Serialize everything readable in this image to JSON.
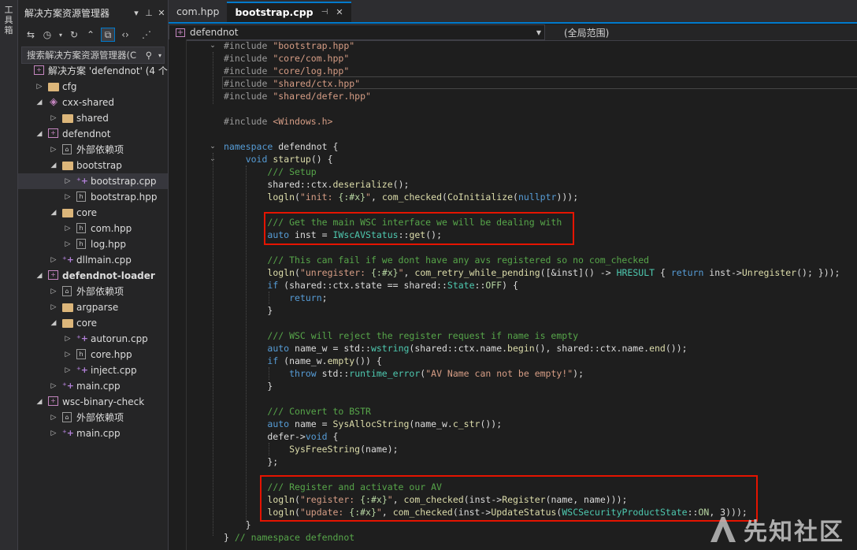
{
  "toolstrip": {
    "label": "工具箱"
  },
  "solution_explorer": {
    "title": "解决方案资源管理器",
    "search_placeholder": "搜索解决方案资源管理器(C",
    "tree": [
      {
        "label": "解决方案 'defendnot' (4 个",
        "depth": 0,
        "arrow": "",
        "icon": "solution"
      },
      {
        "label": "cfg",
        "depth": 1,
        "arrow": "▷",
        "icon": "folder"
      },
      {
        "label": "cxx-shared",
        "depth": 1,
        "arrow": "◢",
        "icon": "shared-project"
      },
      {
        "label": "shared",
        "depth": 2,
        "arrow": "▷",
        "icon": "folder"
      },
      {
        "label": "defendnot",
        "depth": 1,
        "arrow": "◢",
        "icon": "project"
      },
      {
        "label": "外部依赖项",
        "depth": 2,
        "arrow": "▷",
        "icon": "external"
      },
      {
        "label": "bootstrap",
        "depth": 2,
        "arrow": "◢",
        "icon": "folder"
      },
      {
        "label": "bootstrap.cpp",
        "depth": 3,
        "arrow": "▷",
        "icon": "cpp",
        "selected": true
      },
      {
        "label": "bootstrap.hpp",
        "depth": 3,
        "arrow": "▷",
        "icon": "hpp"
      },
      {
        "label": "core",
        "depth": 2,
        "arrow": "◢",
        "icon": "folder"
      },
      {
        "label": "com.hpp",
        "depth": 3,
        "arrow": "▷",
        "icon": "hpp"
      },
      {
        "label": "log.hpp",
        "depth": 3,
        "arrow": "▷",
        "icon": "hpp"
      },
      {
        "label": "dllmain.cpp",
        "depth": 2,
        "arrow": "▷",
        "icon": "cpp"
      },
      {
        "label": "defendnot-loader",
        "depth": 1,
        "arrow": "◢",
        "icon": "project",
        "bold": true
      },
      {
        "label": "外部依赖项",
        "depth": 2,
        "arrow": "▷",
        "icon": "external"
      },
      {
        "label": "argparse",
        "depth": 2,
        "arrow": "▷",
        "icon": "folder"
      },
      {
        "label": "core",
        "depth": 2,
        "arrow": "◢",
        "icon": "folder"
      },
      {
        "label": "autorun.cpp",
        "depth": 3,
        "arrow": "▷",
        "icon": "cpp"
      },
      {
        "label": "core.hpp",
        "depth": 3,
        "arrow": "▷",
        "icon": "hpp"
      },
      {
        "label": "inject.cpp",
        "depth": 3,
        "arrow": "▷",
        "icon": "cpp"
      },
      {
        "label": "main.cpp",
        "depth": 2,
        "arrow": "▷",
        "icon": "cpp"
      },
      {
        "label": "wsc-binary-check",
        "depth": 1,
        "arrow": "◢",
        "icon": "project"
      },
      {
        "label": "外部依赖项",
        "depth": 2,
        "arrow": "▷",
        "icon": "external"
      },
      {
        "label": "main.cpp",
        "depth": 2,
        "arrow": "▷",
        "icon": "cpp"
      }
    ]
  },
  "editor": {
    "tabs": [
      {
        "label": "com.hpp",
        "active": false
      },
      {
        "label": "bootstrap.cpp",
        "active": true
      }
    ],
    "nav_project": "defendnot",
    "nav_scope": "(全局范围)"
  },
  "watermark": {
    "text": "先知社区"
  }
}
